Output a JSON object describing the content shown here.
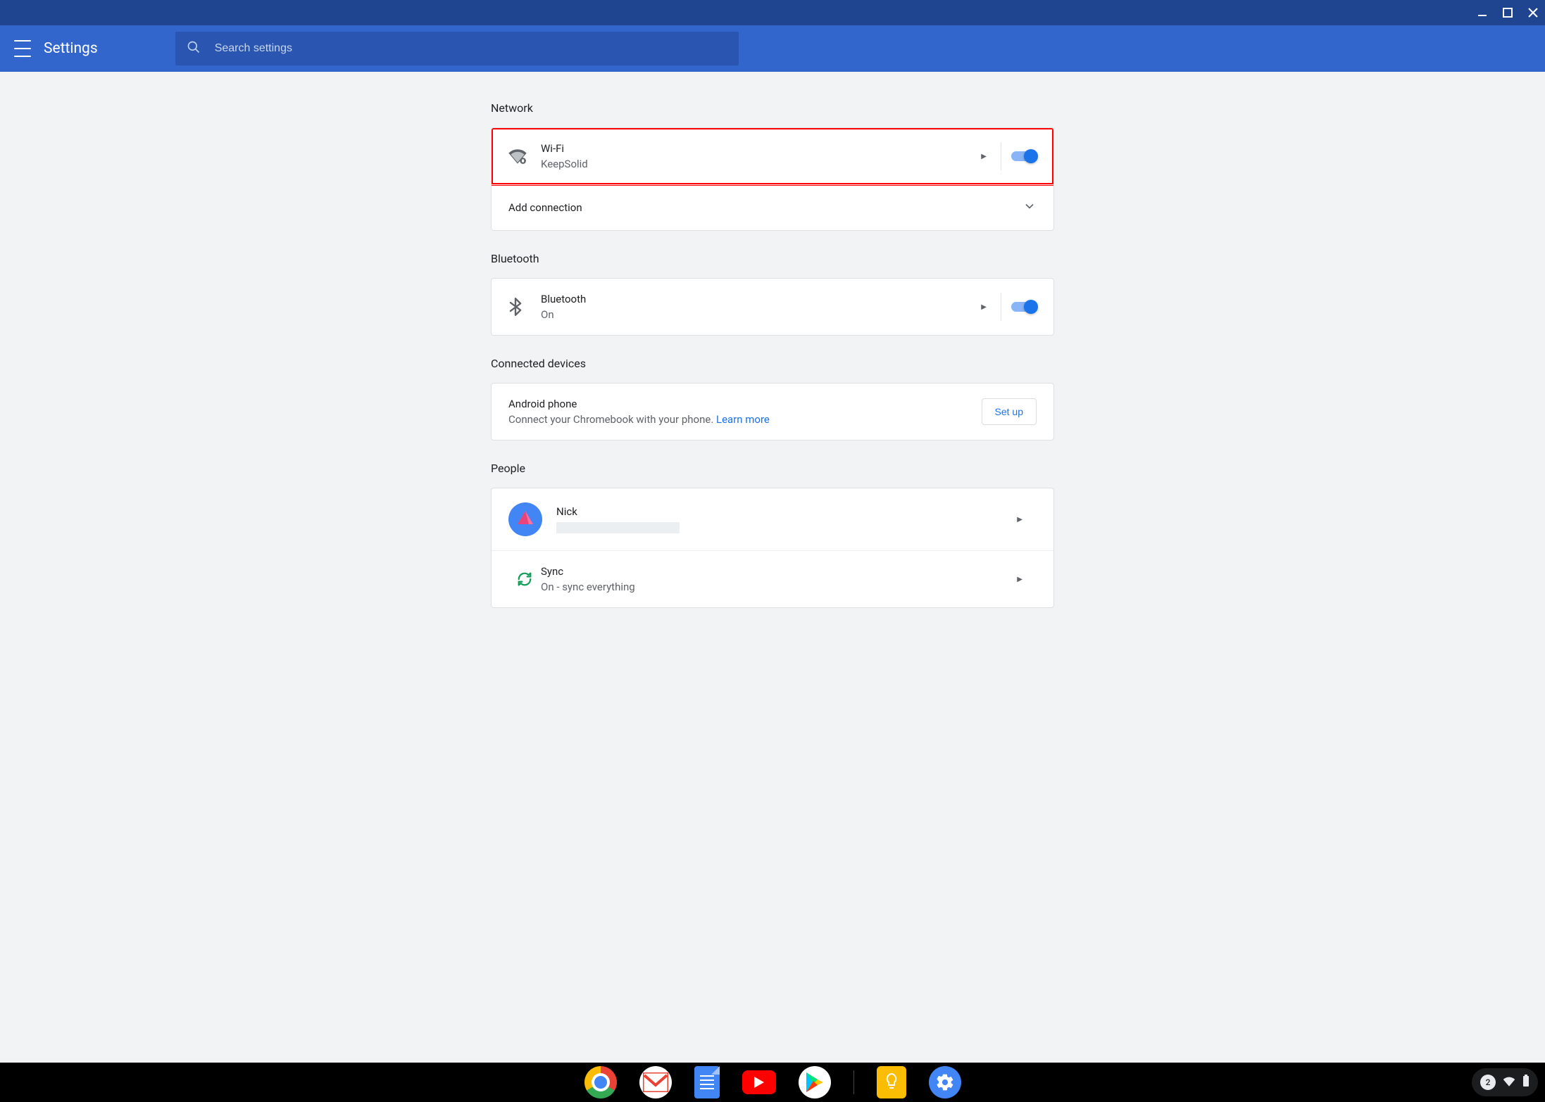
{
  "window_controls": {
    "minimize": "minimize",
    "maximize": "maximize",
    "close": "close"
  },
  "header": {
    "title": "Settings",
    "search_placeholder": "Search settings"
  },
  "sections": {
    "network": {
      "title": "Network",
      "wifi": {
        "label": "Wi-Fi",
        "ssid": "KeepSolid",
        "enabled": true
      },
      "add_connection": "Add connection"
    },
    "bluetooth": {
      "title": "Bluetooth",
      "row": {
        "label": "Bluetooth",
        "status": "On",
        "enabled": true
      }
    },
    "connected": {
      "title": "Connected devices",
      "android": {
        "label": "Android phone",
        "desc": "Connect your Chromebook with your phone. ",
        "learn_more": "Learn more",
        "setup": "Set up"
      }
    },
    "people": {
      "title": "People",
      "user": {
        "name": "Nick"
      },
      "sync": {
        "label": "Sync",
        "status": "On - sync everything"
      }
    }
  },
  "shelf": {
    "apps": [
      "chrome",
      "gmail",
      "docs",
      "youtube",
      "play-store",
      "keep",
      "settings"
    ]
  },
  "tray": {
    "notifications": "2"
  }
}
